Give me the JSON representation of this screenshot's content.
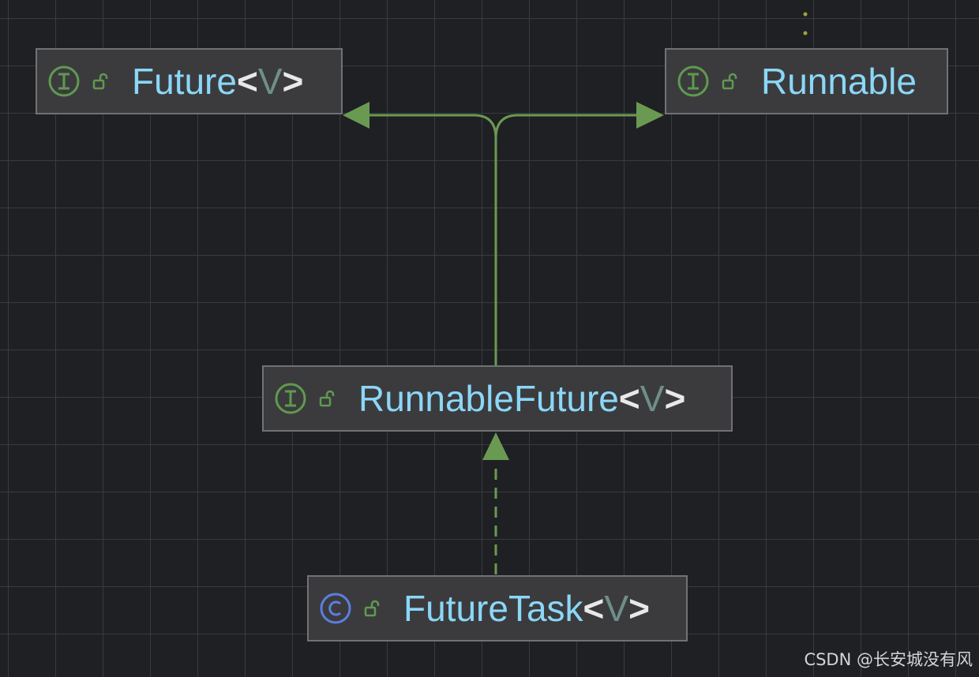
{
  "nodes": {
    "future": {
      "name": "Future",
      "open": "<",
      "param": "V",
      "close": ">",
      "kind": "interface"
    },
    "runnable": {
      "name": "Runnable",
      "kind": "interface"
    },
    "runnable_future": {
      "name": "RunnableFuture",
      "open": "<",
      "param": "V",
      "close": ">",
      "kind": "interface"
    },
    "future_task": {
      "name": "FutureTask",
      "open": "<",
      "param": "V",
      "close": ">",
      "kind": "class"
    }
  },
  "edges": [
    {
      "from": "RunnableFuture",
      "to": "Future",
      "style": "solid",
      "relation": "extends"
    },
    {
      "from": "RunnableFuture",
      "to": "Runnable",
      "style": "solid",
      "relation": "extends"
    },
    {
      "from": "FutureTask",
      "to": "RunnableFuture",
      "style": "dashed",
      "relation": "implements"
    }
  ],
  "icons": {
    "interface": "interface-icon",
    "class": "class-icon",
    "visibility": "open-lock-icon"
  },
  "colors": {
    "background": "#1f2023",
    "grid": "#3a3b3e",
    "node_fill": "#3b3b3e",
    "node_border": "#707275",
    "name_text": "#8bd7f7",
    "type_param": "#6f8f88",
    "interface_icon": "#5f9a4f",
    "class_icon": "#5b7fe0",
    "edge": "#6a9a52"
  },
  "watermark": "CSDN @长安城没有风"
}
